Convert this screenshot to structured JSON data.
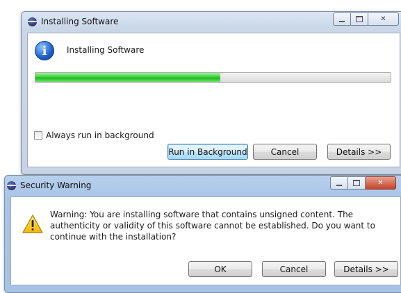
{
  "install_dialog": {
    "title": "Installing Software",
    "window_controls": {
      "minimize": "minimize-icon",
      "maximize": "maximize-icon",
      "close": "close-icon"
    },
    "heading": "Installing Software",
    "progress_percent": 52,
    "progress_color": "#3ad23a",
    "checkbox_label": "Always run in background",
    "checkbox_checked": false,
    "buttons": {
      "run_in_background": "Run in Background",
      "cancel": "Cancel",
      "details": "Details >>"
    }
  },
  "security_dialog": {
    "title": "Security Warning",
    "window_controls": {
      "minimize": "minimize-icon",
      "maximize": "maximize-icon",
      "close": "close-icon"
    },
    "message": "Warning: You are installing software that contains unsigned content. The authenticity or validity of this software cannot be established. Do you want to continue with the installation?",
    "buttons": {
      "ok": "OK",
      "cancel": "Cancel",
      "details": "Details >>"
    }
  }
}
